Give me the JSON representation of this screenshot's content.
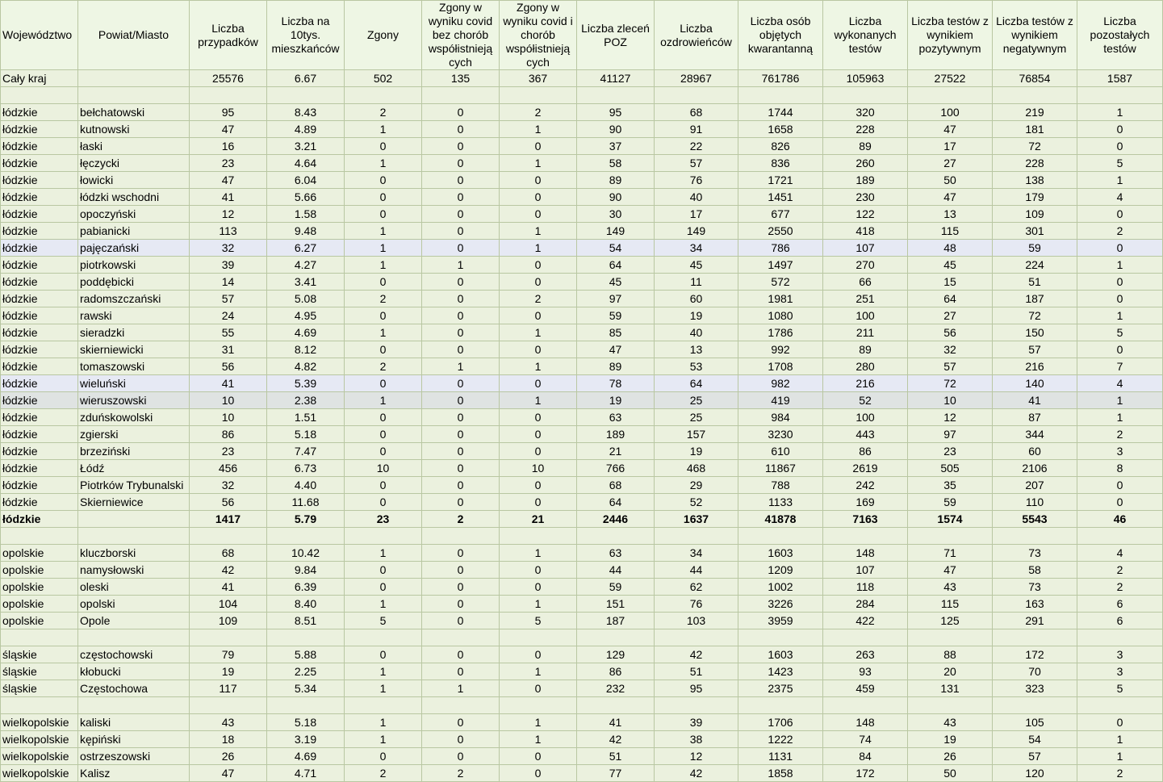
{
  "columns": [
    "Województwo",
    "Powiat/Miasto",
    "Liczba przypadków",
    "Liczba na 10tys. mieszkańców",
    "Zgony",
    "Zgony w wyniku covid bez chorób współistnieją cych",
    "Zgony w wyniku covid i chorób współistnieją cych",
    "Liczba zleceń POZ",
    "Liczba ozdrowieńców",
    "Liczba osób objętych kwarantanną",
    "Liczba wykonanych testów",
    "Liczba testów z wynikiem pozytywnym",
    "Liczba testów z wynikiem negatywnym",
    "Liczba pozostałych testów"
  ],
  "rows": [
    {
      "type": "data",
      "cells": [
        "Cały kraj",
        "",
        "25576",
        "6.67",
        "502",
        "135",
        "367",
        "41127",
        "28967",
        "761786",
        "105963",
        "27522",
        "76854",
        "1587"
      ]
    },
    {
      "type": "blank"
    },
    {
      "type": "data",
      "cells": [
        "łódzkie",
        "bełchatowski",
        "95",
        "8.43",
        "2",
        "0",
        "2",
        "95",
        "68",
        "1744",
        "320",
        "100",
        "219",
        "1"
      ]
    },
    {
      "type": "data",
      "cells": [
        "łódzkie",
        "kutnowski",
        "47",
        "4.89",
        "1",
        "0",
        "1",
        "90",
        "91",
        "1658",
        "228",
        "47",
        "181",
        "0"
      ]
    },
    {
      "type": "data",
      "cells": [
        "łódzkie",
        "łaski",
        "16",
        "3.21",
        "0",
        "0",
        "0",
        "37",
        "22",
        "826",
        "89",
        "17",
        "72",
        "0"
      ]
    },
    {
      "type": "data",
      "cells": [
        "łódzkie",
        "łęczycki",
        "23",
        "4.64",
        "1",
        "0",
        "1",
        "58",
        "57",
        "836",
        "260",
        "27",
        "228",
        "5"
      ]
    },
    {
      "type": "data",
      "cells": [
        "łódzkie",
        "łowicki",
        "47",
        "6.04",
        "0",
        "0",
        "0",
        "89",
        "76",
        "1721",
        "189",
        "50",
        "138",
        "1"
      ]
    },
    {
      "type": "data",
      "cells": [
        "łódzkie",
        "łódzki wschodni",
        "41",
        "5.66",
        "0",
        "0",
        "0",
        "90",
        "40",
        "1451",
        "230",
        "47",
        "179",
        "4"
      ]
    },
    {
      "type": "data",
      "cells": [
        "łódzkie",
        "opoczyński",
        "12",
        "1.58",
        "0",
        "0",
        "0",
        "30",
        "17",
        "677",
        "122",
        "13",
        "109",
        "0"
      ]
    },
    {
      "type": "data",
      "cells": [
        "łódzkie",
        "pabianicki",
        "113",
        "9.48",
        "1",
        "0",
        "1",
        "149",
        "149",
        "2550",
        "418",
        "115",
        "301",
        "2"
      ]
    },
    {
      "type": "data",
      "hl": "blue",
      "cells": [
        "łódzkie",
        "pajęczański",
        "32",
        "6.27",
        "1",
        "0",
        "1",
        "54",
        "34",
        "786",
        "107",
        "48",
        "59",
        "0"
      ]
    },
    {
      "type": "data",
      "cells": [
        "łódzkie",
        "piotrkowski",
        "39",
        "4.27",
        "1",
        "1",
        "0",
        "64",
        "45",
        "1497",
        "270",
        "45",
        "224",
        "1"
      ]
    },
    {
      "type": "data",
      "cells": [
        "łódzkie",
        "poddębicki",
        "14",
        "3.41",
        "0",
        "0",
        "0",
        "45",
        "11",
        "572",
        "66",
        "15",
        "51",
        "0"
      ]
    },
    {
      "type": "data",
      "cells": [
        "łódzkie",
        "radomszczański",
        "57",
        "5.08",
        "2",
        "0",
        "2",
        "97",
        "60",
        "1981",
        "251",
        "64",
        "187",
        "0"
      ]
    },
    {
      "type": "data",
      "cells": [
        "łódzkie",
        "rawski",
        "24",
        "4.95",
        "0",
        "0",
        "0",
        "59",
        "19",
        "1080",
        "100",
        "27",
        "72",
        "1"
      ]
    },
    {
      "type": "data",
      "cells": [
        "łódzkie",
        "sieradzki",
        "55",
        "4.69",
        "1",
        "0",
        "1",
        "85",
        "40",
        "1786",
        "211",
        "56",
        "150",
        "5"
      ]
    },
    {
      "type": "data",
      "cells": [
        "łódzkie",
        "skierniewicki",
        "31",
        "8.12",
        "0",
        "0",
        "0",
        "47",
        "13",
        "992",
        "89",
        "32",
        "57",
        "0"
      ]
    },
    {
      "type": "data",
      "cells": [
        "łódzkie",
        "tomaszowski",
        "56",
        "4.82",
        "2",
        "1",
        "1",
        "89",
        "53",
        "1708",
        "280",
        "57",
        "216",
        "7"
      ]
    },
    {
      "type": "data",
      "hl": "blue",
      "cells": [
        "łódzkie",
        "wieluński",
        "41",
        "5.39",
        "0",
        "0",
        "0",
        "78",
        "64",
        "982",
        "216",
        "72",
        "140",
        "4"
      ]
    },
    {
      "type": "data",
      "hl": "grey",
      "cells": [
        "łódzkie",
        "wieruszowski",
        "10",
        "2.38",
        "1",
        "0",
        "1",
        "19",
        "25",
        "419",
        "52",
        "10",
        "41",
        "1"
      ]
    },
    {
      "type": "data",
      "cells": [
        "łódzkie",
        "zduńskowolski",
        "10",
        "1.51",
        "0",
        "0",
        "0",
        "63",
        "25",
        "984",
        "100",
        "12",
        "87",
        "1"
      ]
    },
    {
      "type": "data",
      "cells": [
        "łódzkie",
        "zgierski",
        "86",
        "5.18",
        "0",
        "0",
        "0",
        "189",
        "157",
        "3230",
        "443",
        "97",
        "344",
        "2"
      ]
    },
    {
      "type": "data",
      "cells": [
        "łódzkie",
        "brzeziński",
        "23",
        "7.47",
        "0",
        "0",
        "0",
        "21",
        "19",
        "610",
        "86",
        "23",
        "60",
        "3"
      ]
    },
    {
      "type": "data",
      "cells": [
        "łódzkie",
        "Łódź",
        "456",
        "6.73",
        "10",
        "0",
        "10",
        "766",
        "468",
        "11867",
        "2619",
        "505",
        "2106",
        "8"
      ]
    },
    {
      "type": "data",
      "cells": [
        "łódzkie",
        "Piotrków Trybunalski",
        "32",
        "4.40",
        "0",
        "0",
        "0",
        "68",
        "29",
        "788",
        "242",
        "35",
        "207",
        "0"
      ]
    },
    {
      "type": "data",
      "cells": [
        "łódzkie",
        "Skierniewice",
        "56",
        "11.68",
        "0",
        "0",
        "0",
        "64",
        "52",
        "1133",
        "169",
        "59",
        "110",
        "0"
      ]
    },
    {
      "type": "total",
      "cells": [
        "łódzkie",
        "",
        "1417",
        "5.79",
        "23",
        "2",
        "21",
        "2446",
        "1637",
        "41878",
        "7163",
        "1574",
        "5543",
        "46"
      ]
    },
    {
      "type": "blank"
    },
    {
      "type": "data",
      "cells": [
        "opolskie",
        "kluczborski",
        "68",
        "10.42",
        "1",
        "0",
        "1",
        "63",
        "34",
        "1603",
        "148",
        "71",
        "73",
        "4"
      ]
    },
    {
      "type": "data",
      "cells": [
        "opolskie",
        "namysłowski",
        "42",
        "9.84",
        "0",
        "0",
        "0",
        "44",
        "44",
        "1209",
        "107",
        "47",
        "58",
        "2"
      ]
    },
    {
      "type": "data",
      "cells": [
        "opolskie",
        "oleski",
        "41",
        "6.39",
        "0",
        "0",
        "0",
        "59",
        "62",
        "1002",
        "118",
        "43",
        "73",
        "2"
      ]
    },
    {
      "type": "data",
      "cells": [
        "opolskie",
        "opolski",
        "104",
        "8.40",
        "1",
        "0",
        "1",
        "151",
        "76",
        "3226",
        "284",
        "115",
        "163",
        "6"
      ]
    },
    {
      "type": "data",
      "cells": [
        "opolskie",
        "Opole",
        "109",
        "8.51",
        "5",
        "0",
        "5",
        "187",
        "103",
        "3959",
        "422",
        "125",
        "291",
        "6"
      ]
    },
    {
      "type": "blank"
    },
    {
      "type": "data",
      "cells": [
        "śląskie",
        "częstochowski",
        "79",
        "5.88",
        "0",
        "0",
        "0",
        "129",
        "42",
        "1603",
        "263",
        "88",
        "172",
        "3"
      ]
    },
    {
      "type": "data",
      "cells": [
        "śląskie",
        "kłobucki",
        "19",
        "2.25",
        "1",
        "0",
        "1",
        "86",
        "51",
        "1423",
        "93",
        "20",
        "70",
        "3"
      ]
    },
    {
      "type": "data",
      "cells": [
        "śląskie",
        "Częstochowa",
        "117",
        "5.34",
        "1",
        "1",
        "0",
        "232",
        "95",
        "2375",
        "459",
        "131",
        "323",
        "5"
      ]
    },
    {
      "type": "blank"
    },
    {
      "type": "data",
      "cells": [
        "wielkopolskie",
        "kaliski",
        "43",
        "5.18",
        "1",
        "0",
        "1",
        "41",
        "39",
        "1706",
        "148",
        "43",
        "105",
        "0"
      ]
    },
    {
      "type": "data",
      "cells": [
        "wielkopolskie",
        "kępiński",
        "18",
        "3.19",
        "1",
        "0",
        "1",
        "42",
        "38",
        "1222",
        "74",
        "19",
        "54",
        "1"
      ]
    },
    {
      "type": "data",
      "cells": [
        "wielkopolskie",
        "ostrzeszowski",
        "26",
        "4.69",
        "0",
        "0",
        "0",
        "51",
        "12",
        "1131",
        "84",
        "26",
        "57",
        "1"
      ]
    },
    {
      "type": "data",
      "cells": [
        "wielkopolskie",
        "Kalisz",
        "47",
        "4.71",
        "2",
        "2",
        "0",
        "77",
        "42",
        "1858",
        "172",
        "50",
        "120",
        "2"
      ]
    }
  ]
}
